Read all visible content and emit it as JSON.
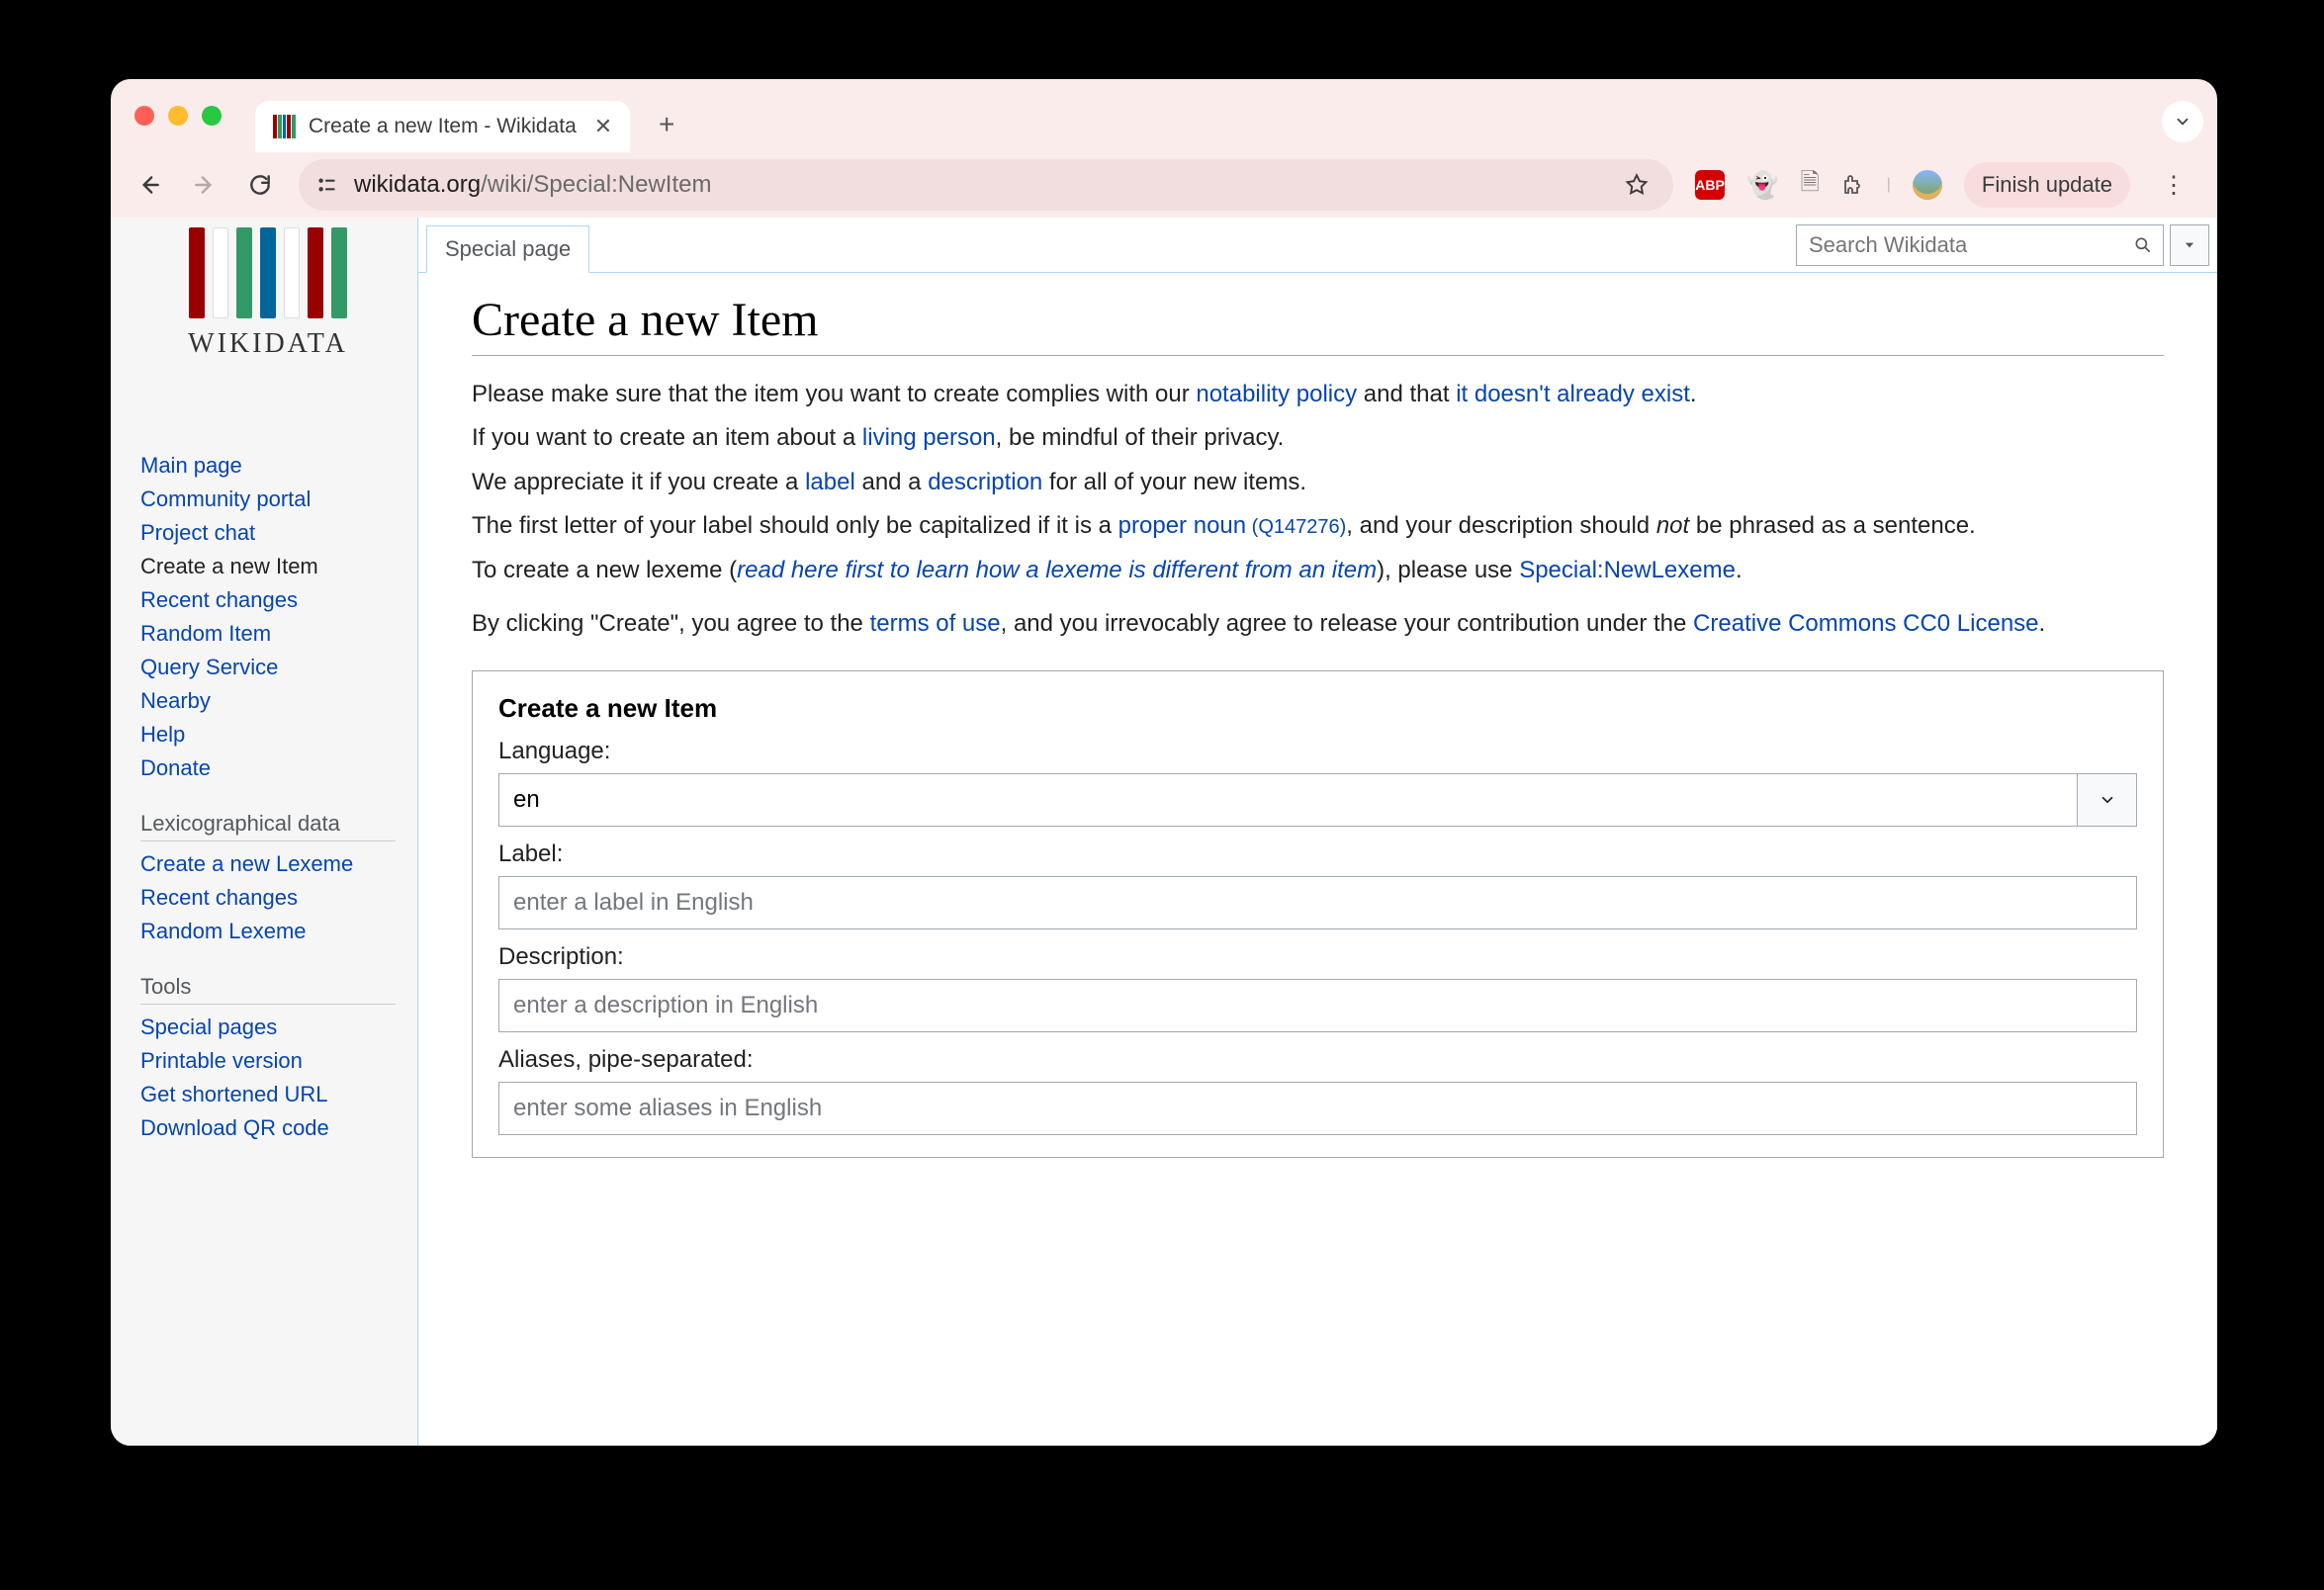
{
  "browser": {
    "tab_title": "Create a new Item - Wikidata",
    "url_host": "wikidata.org",
    "url_path": "/wiki/Special:NewItem",
    "finish_update": "Finish update",
    "abp": "ABP"
  },
  "logo_text": "WIKIDATA",
  "sidebar": {
    "nav": [
      {
        "label": "Main page"
      },
      {
        "label": "Community portal"
      },
      {
        "label": "Project chat"
      },
      {
        "label": "Create a new Item",
        "current": true
      },
      {
        "label": "Recent changes"
      },
      {
        "label": "Random Item"
      },
      {
        "label": "Query Service"
      },
      {
        "label": "Nearby"
      },
      {
        "label": "Help"
      },
      {
        "label": "Donate"
      }
    ],
    "lex_title": "Lexicographical data",
    "lex": [
      {
        "label": "Create a new Lexeme"
      },
      {
        "label": "Recent changes"
      },
      {
        "label": "Random Lexeme"
      }
    ],
    "tools_title": "Tools",
    "tools": [
      {
        "label": "Special pages"
      },
      {
        "label": "Printable version"
      },
      {
        "label": "Get shortened URL"
      },
      {
        "label": "Download QR code"
      }
    ]
  },
  "tabs": {
    "special": "Special page"
  },
  "search_placeholder": "Search Wikidata",
  "title": "Create a new Item",
  "intro": {
    "p1a": "Please make sure that the item you want to create complies with our ",
    "p1_link1": "notability policy",
    "p1b": " and that ",
    "p1_link2": "it doesn't already exist",
    "p1c": ".",
    "p2a": "If you want to create an item about a ",
    "p2_link": "living person",
    "p2b": ", be mindful of their privacy.",
    "p3a": "We appreciate it if you create a ",
    "p3_link1": "label",
    "p3b": " and a ",
    "p3_link2": "description",
    "p3c": " for all of your new items.",
    "p4a": "The first letter of your label should only be capitalized if it is a ",
    "p4_link": "proper noun",
    "p4_qid": " (Q147276)",
    "p4b": ", and your description should ",
    "p4_not": "not",
    "p4c": " be phrased as a sentence.",
    "p5a": "To create a new lexeme (",
    "p5_link1": "read here first to learn how a lexeme is different from an item",
    "p5b": "), please use ",
    "p5_link2": "Special:NewLexeme",
    "p5c": ".",
    "p6a": "By clicking \"Create\", you agree to the ",
    "p6_link1": "terms of use",
    "p6b": ", and you irrevocably agree to release your contribution under the ",
    "p6_link2": "Creative Commons CC0 License",
    "p6c": "."
  },
  "form": {
    "box_title": "Create a new Item",
    "lang_label": "Language:",
    "lang_value": "en",
    "label_label": "Label:",
    "label_placeholder": "enter a label in English",
    "desc_label": "Description:",
    "desc_placeholder": "enter a description in English",
    "alias_label": "Aliases, pipe-separated:",
    "alias_placeholder": "enter some aliases in English"
  }
}
